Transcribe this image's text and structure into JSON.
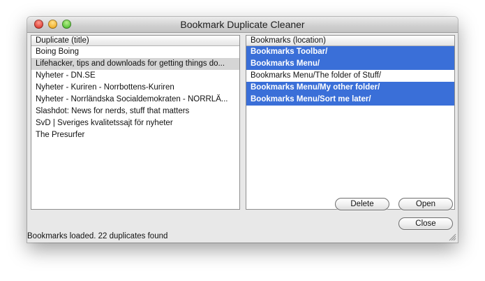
{
  "window": {
    "title": "Bookmark Duplicate Cleaner"
  },
  "left_panel": {
    "header": "Duplicate (title)",
    "rows": [
      "Boing Boing",
      "Lifehacker, tips and downloads for getting things do...",
      "Nyheter - DN.SE",
      "Nyheter - Kuriren - Norrbottens-Kuriren",
      "Nyheter - Norrländska Socialdemokraten - NORRLÄ...",
      "Slashdot: News for nerds, stuff that matters",
      "SvD | Sveriges kvalitetssajt för nyheter",
      "The Presurfer"
    ],
    "highlighted_index": 1
  },
  "right_panel": {
    "header": "Bookmarks (location)",
    "rows": [
      {
        "label": "Bookmarks Toolbar/",
        "selected": true
      },
      {
        "label": "Bookmarks Menu/",
        "selected": true
      },
      {
        "label": "Bookmarks Menu/The folder of Stuff/",
        "selected": false
      },
      {
        "label": "Bookmarks Menu/My other folder/",
        "selected": true
      },
      {
        "label": "Bookmarks Menu/Sort me later/",
        "selected": true
      }
    ]
  },
  "buttons": {
    "delete": "Delete",
    "open": "Open",
    "close": "Close"
  },
  "status": "Bookmarks loaded. 22 duplicates found",
  "colors": {
    "selection": "#3a6fd8",
    "row_highlight": "#d5d5d5"
  }
}
